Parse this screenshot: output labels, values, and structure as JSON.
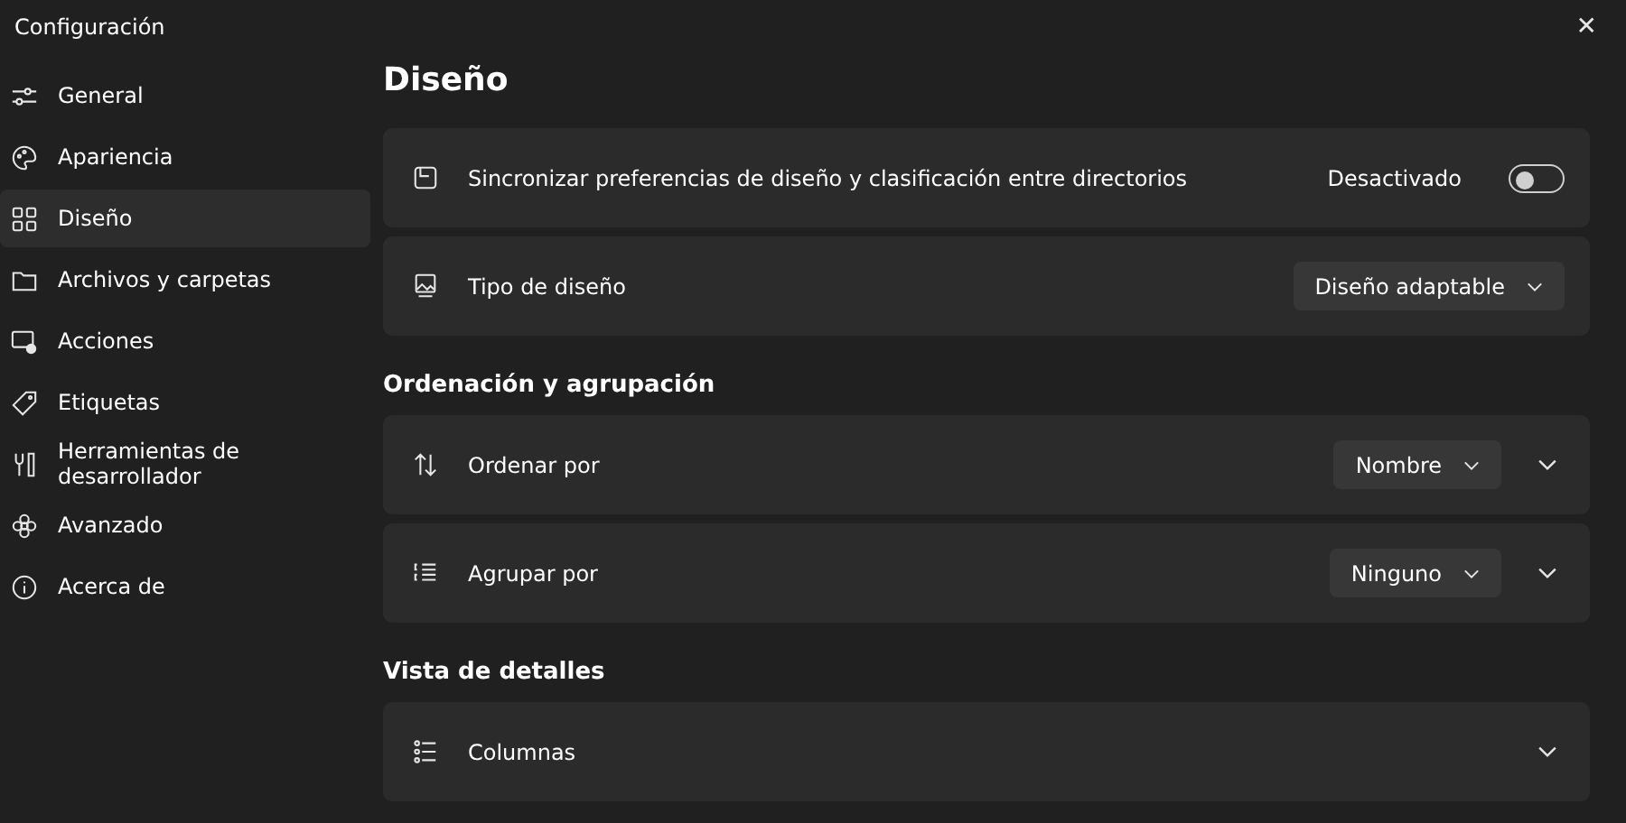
{
  "window": {
    "title": "Configuración",
    "close": "✕"
  },
  "sidebar": {
    "items": [
      {
        "label": "General",
        "selected": false
      },
      {
        "label": "Apariencia",
        "selected": false
      },
      {
        "label": "Diseño",
        "selected": true
      },
      {
        "label": "Archivos y carpetas",
        "selected": false
      },
      {
        "label": "Acciones",
        "selected": false
      },
      {
        "label": "Etiquetas",
        "selected": false
      },
      {
        "label": "Herramientas de desarrollador",
        "selected": false
      },
      {
        "label": "Avanzado",
        "selected": false
      },
      {
        "label": "Acerca de",
        "selected": false
      }
    ]
  },
  "page_title": "Diseño",
  "sections": [
    {
      "settings": [
        {
          "kind": "toggle",
          "label": "Sincronizar preferencias de diseño y clasificación entre directorios",
          "state_text": "Desactivado",
          "on": false
        },
        {
          "kind": "dropdown",
          "label": "Tipo de diseño",
          "value": "Diseño adaptable"
        }
      ]
    },
    {
      "heading": "Ordenación y agrupación",
      "settings": [
        {
          "kind": "dropdown",
          "label": "Ordenar por",
          "value": "Nombre",
          "expanded": false
        },
        {
          "kind": "dropdown",
          "label": "Agrupar por",
          "value": "Ninguno",
          "expanded": false
        }
      ]
    },
    {
      "heading": "Vista de detalles",
      "settings": [
        {
          "kind": "expander",
          "label": "Columnas",
          "expanded": false
        }
      ]
    }
  ]
}
